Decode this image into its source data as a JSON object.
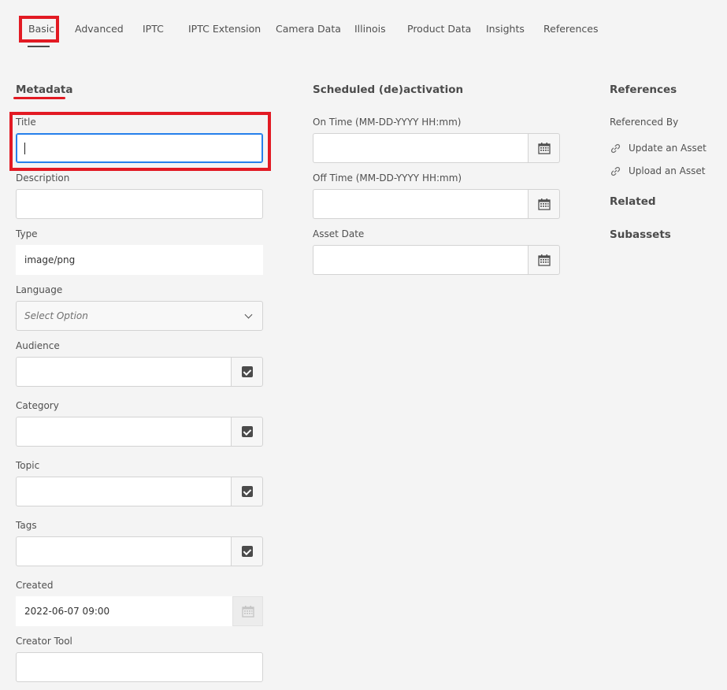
{
  "tabs": [
    {
      "label": "Basic",
      "active": true
    },
    {
      "label": "Advanced"
    },
    {
      "label": "IPTC"
    },
    {
      "label": "IPTC Extension"
    },
    {
      "label": "Camera Data"
    },
    {
      "label": "Illinois"
    },
    {
      "label": "Product Data"
    },
    {
      "label": "Insights"
    },
    {
      "label": "References"
    }
  ],
  "metadata": {
    "heading": "Metadata",
    "title_label": "Title",
    "title_value": "",
    "description_label": "Description",
    "type_label": "Type",
    "type_value": "image/png",
    "language_label": "Language",
    "language_placeholder": "Select Option",
    "audience_label": "Audience",
    "category_label": "Category",
    "topic_label": "Topic",
    "tags_label": "Tags",
    "created_label": "Created",
    "created_value": "2022-06-07 09:00",
    "creator_tool_label": "Creator Tool"
  },
  "scheduled": {
    "heading": "Scheduled (de)activation",
    "on_time_label": "On Time (MM-DD-YYYY HH:mm)",
    "off_time_label": "Off Time (MM-DD-YYYY HH:mm)",
    "asset_date_label": "Asset Date"
  },
  "references": {
    "heading": "References",
    "referenced_by_label": "Referenced By",
    "links": [
      "Update an Asset",
      "Upload an Asset"
    ],
    "related_heading": "Related",
    "subassets_heading": "Subassets"
  },
  "colors": {
    "highlight_red": "#e21a23",
    "focus_blue": "#2680eb",
    "background": "#f4f4f4"
  }
}
